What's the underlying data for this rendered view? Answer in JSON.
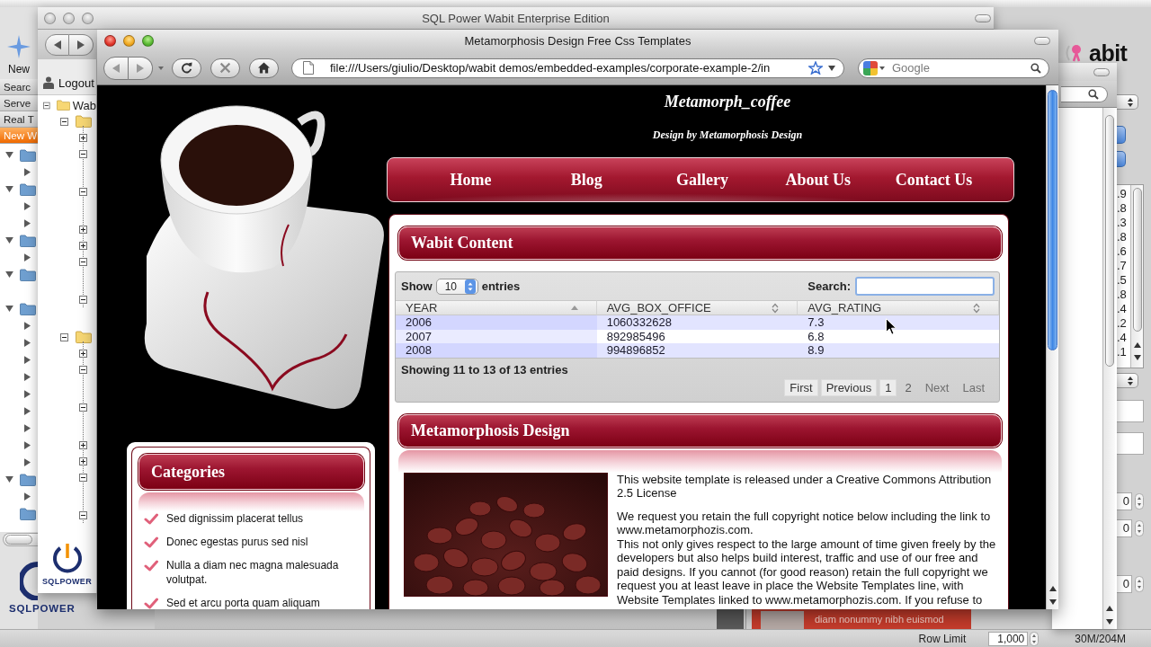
{
  "desktop": {
    "new_button": {
      "label": "New"
    },
    "sidebar_tabs": [
      {
        "label": "Searc",
        "selected": false
      },
      {
        "label": "Serve",
        "selected": false
      },
      {
        "label": "Real T",
        "selected": false
      },
      {
        "label": "New W",
        "selected": true
      }
    ],
    "tree": [
      {
        "kind": "folder",
        "expanded": true,
        "children": [
          {
            "expanded": false
          }
        ]
      },
      {
        "kind": "folder",
        "expanded": true,
        "children": [
          {
            "expanded": false
          },
          {
            "expanded": false
          }
        ]
      },
      {
        "kind": "folder",
        "expanded": true,
        "children": [
          {
            "expanded": false
          }
        ]
      },
      {
        "kind": "folder",
        "expanded": true
      },
      {
        "kind": "folder",
        "expanded": true,
        "children": [
          {
            "expanded": false
          },
          {
            "expanded": false
          },
          {
            "expanded": false
          },
          {
            "expanded": false
          },
          {
            "expanded": false
          },
          {
            "expanded": false
          },
          {
            "expanded": false
          },
          {
            "expanded": false
          },
          {
            "expanded": false
          }
        ]
      },
      {
        "kind": "folder",
        "expanded": true,
        "children": [
          {
            "expanded": false
          }
        ]
      },
      {
        "kind": "folder"
      }
    ],
    "logo": "SQLPOWER",
    "brand": "abit",
    "values": [
      ".9",
      ".8",
      ".3",
      ".8",
      ".6",
      ".7",
      ".5",
      ".8",
      ".4",
      ".2",
      ".4",
      ".1"
    ],
    "spinners": [
      "0",
      "0",
      "0"
    ],
    "banner": "diam nonummy nibh euismod",
    "status_bar": {
      "row_limit_label": "Row Limit",
      "row_limit": "1,000",
      "memory": "30M/204M"
    }
  },
  "wabit_window": {
    "title": "SQL Power Wabit Enterprise Edition",
    "logout": "Logout",
    "tree": [
      {
        "label": "Wab",
        "expanded": true,
        "children": [
          {
            "expanded": true,
            "children": [
              {
                "expanded": false
              },
              {
                "expanded": true
              },
              {
                "expanded": true
              },
              {
                "expanded": false
              },
              {
                "expanded": false
              },
              {
                "expanded": true
              },
              {
                "expanded": true
              }
            ]
          },
          {
            "expanded": true,
            "children": [
              {
                "expanded": false
              },
              {
                "expanded": true
              },
              {
                "expanded": true
              },
              {
                "expanded": false
              },
              {
                "expanded": false
              },
              {
                "expanded": true
              },
              {
                "expanded": true
              }
            ]
          }
        ]
      }
    ],
    "logo": "SQLPOWER"
  },
  "browser": {
    "title": "Metamorphosis Design Free Css Templates",
    "url": "file:///Users/giulio/Desktop/wabit demos/embedded-examples/corporate-example-2/in",
    "search": {
      "placeholder": "Google"
    },
    "page": {
      "site_title": "Metamorph_coffee",
      "tagline": "Design by Metamorphosis Design",
      "nav": [
        {
          "label": "Home"
        },
        {
          "label": "Blog"
        },
        {
          "label": "Gallery"
        },
        {
          "label": "About Us"
        },
        {
          "label": "Contact Us"
        }
      ],
      "wabit_content": {
        "title": "Wabit Content",
        "length_before": "Show",
        "length_value": "10",
        "length_after": "entries",
        "search_label": "Search:",
        "columns": [
          {
            "label": "YEAR",
            "sorted": true
          },
          {
            "label": "AVG_BOX_OFFICE",
            "sorted": false
          },
          {
            "label": "AVG_RATING",
            "sorted": false
          }
        ],
        "rows": [
          [
            "2006",
            "1060332628",
            "7.3"
          ],
          [
            "2007",
            "892985496",
            "6.8"
          ],
          [
            "2008",
            "994896852",
            "8.9"
          ]
        ],
        "info": "Showing 11 to 13 of 13 entries",
        "pages": [
          {
            "label": "First",
            "selected": false,
            "disabled": false
          },
          {
            "label": "Previous",
            "selected": false,
            "disabled": false
          },
          {
            "label": "1",
            "selected": false,
            "disabled": false
          },
          {
            "label": "2",
            "selected": true,
            "disabled": false
          },
          {
            "label": "Next",
            "selected": false,
            "disabled": true
          },
          {
            "label": "Last",
            "selected": false,
            "disabled": true
          }
        ]
      },
      "article": {
        "title": "Metamorphosis Design",
        "paragraphs": [
          "This website template is released under a Creative Commons Attribution\n2.5 License",
          "We request you retain the full copyright notice below including the link to\nwww.metamorphozis.com.",
          "This not only gives respect to the large amount of time given freely by the\ndevelopers but also helps build interest, traffic and use of our free and\npaid designs. If you cannot (for good reason) retain the full copyright we\nrequest you at least leave in place the Website Templates line, with\nWebsite Templates linked to www.metamorphozis.com. If you refuse to"
        ]
      },
      "categories": {
        "title": "Categories",
        "items": [
          "Sed dignissim placerat tellus",
          "Donec egestas purus sed nisl",
          "Nulla a diam nec magna malesuada volutpat.",
          "Sed et arcu porta quam aliquam"
        ]
      }
    }
  }
}
